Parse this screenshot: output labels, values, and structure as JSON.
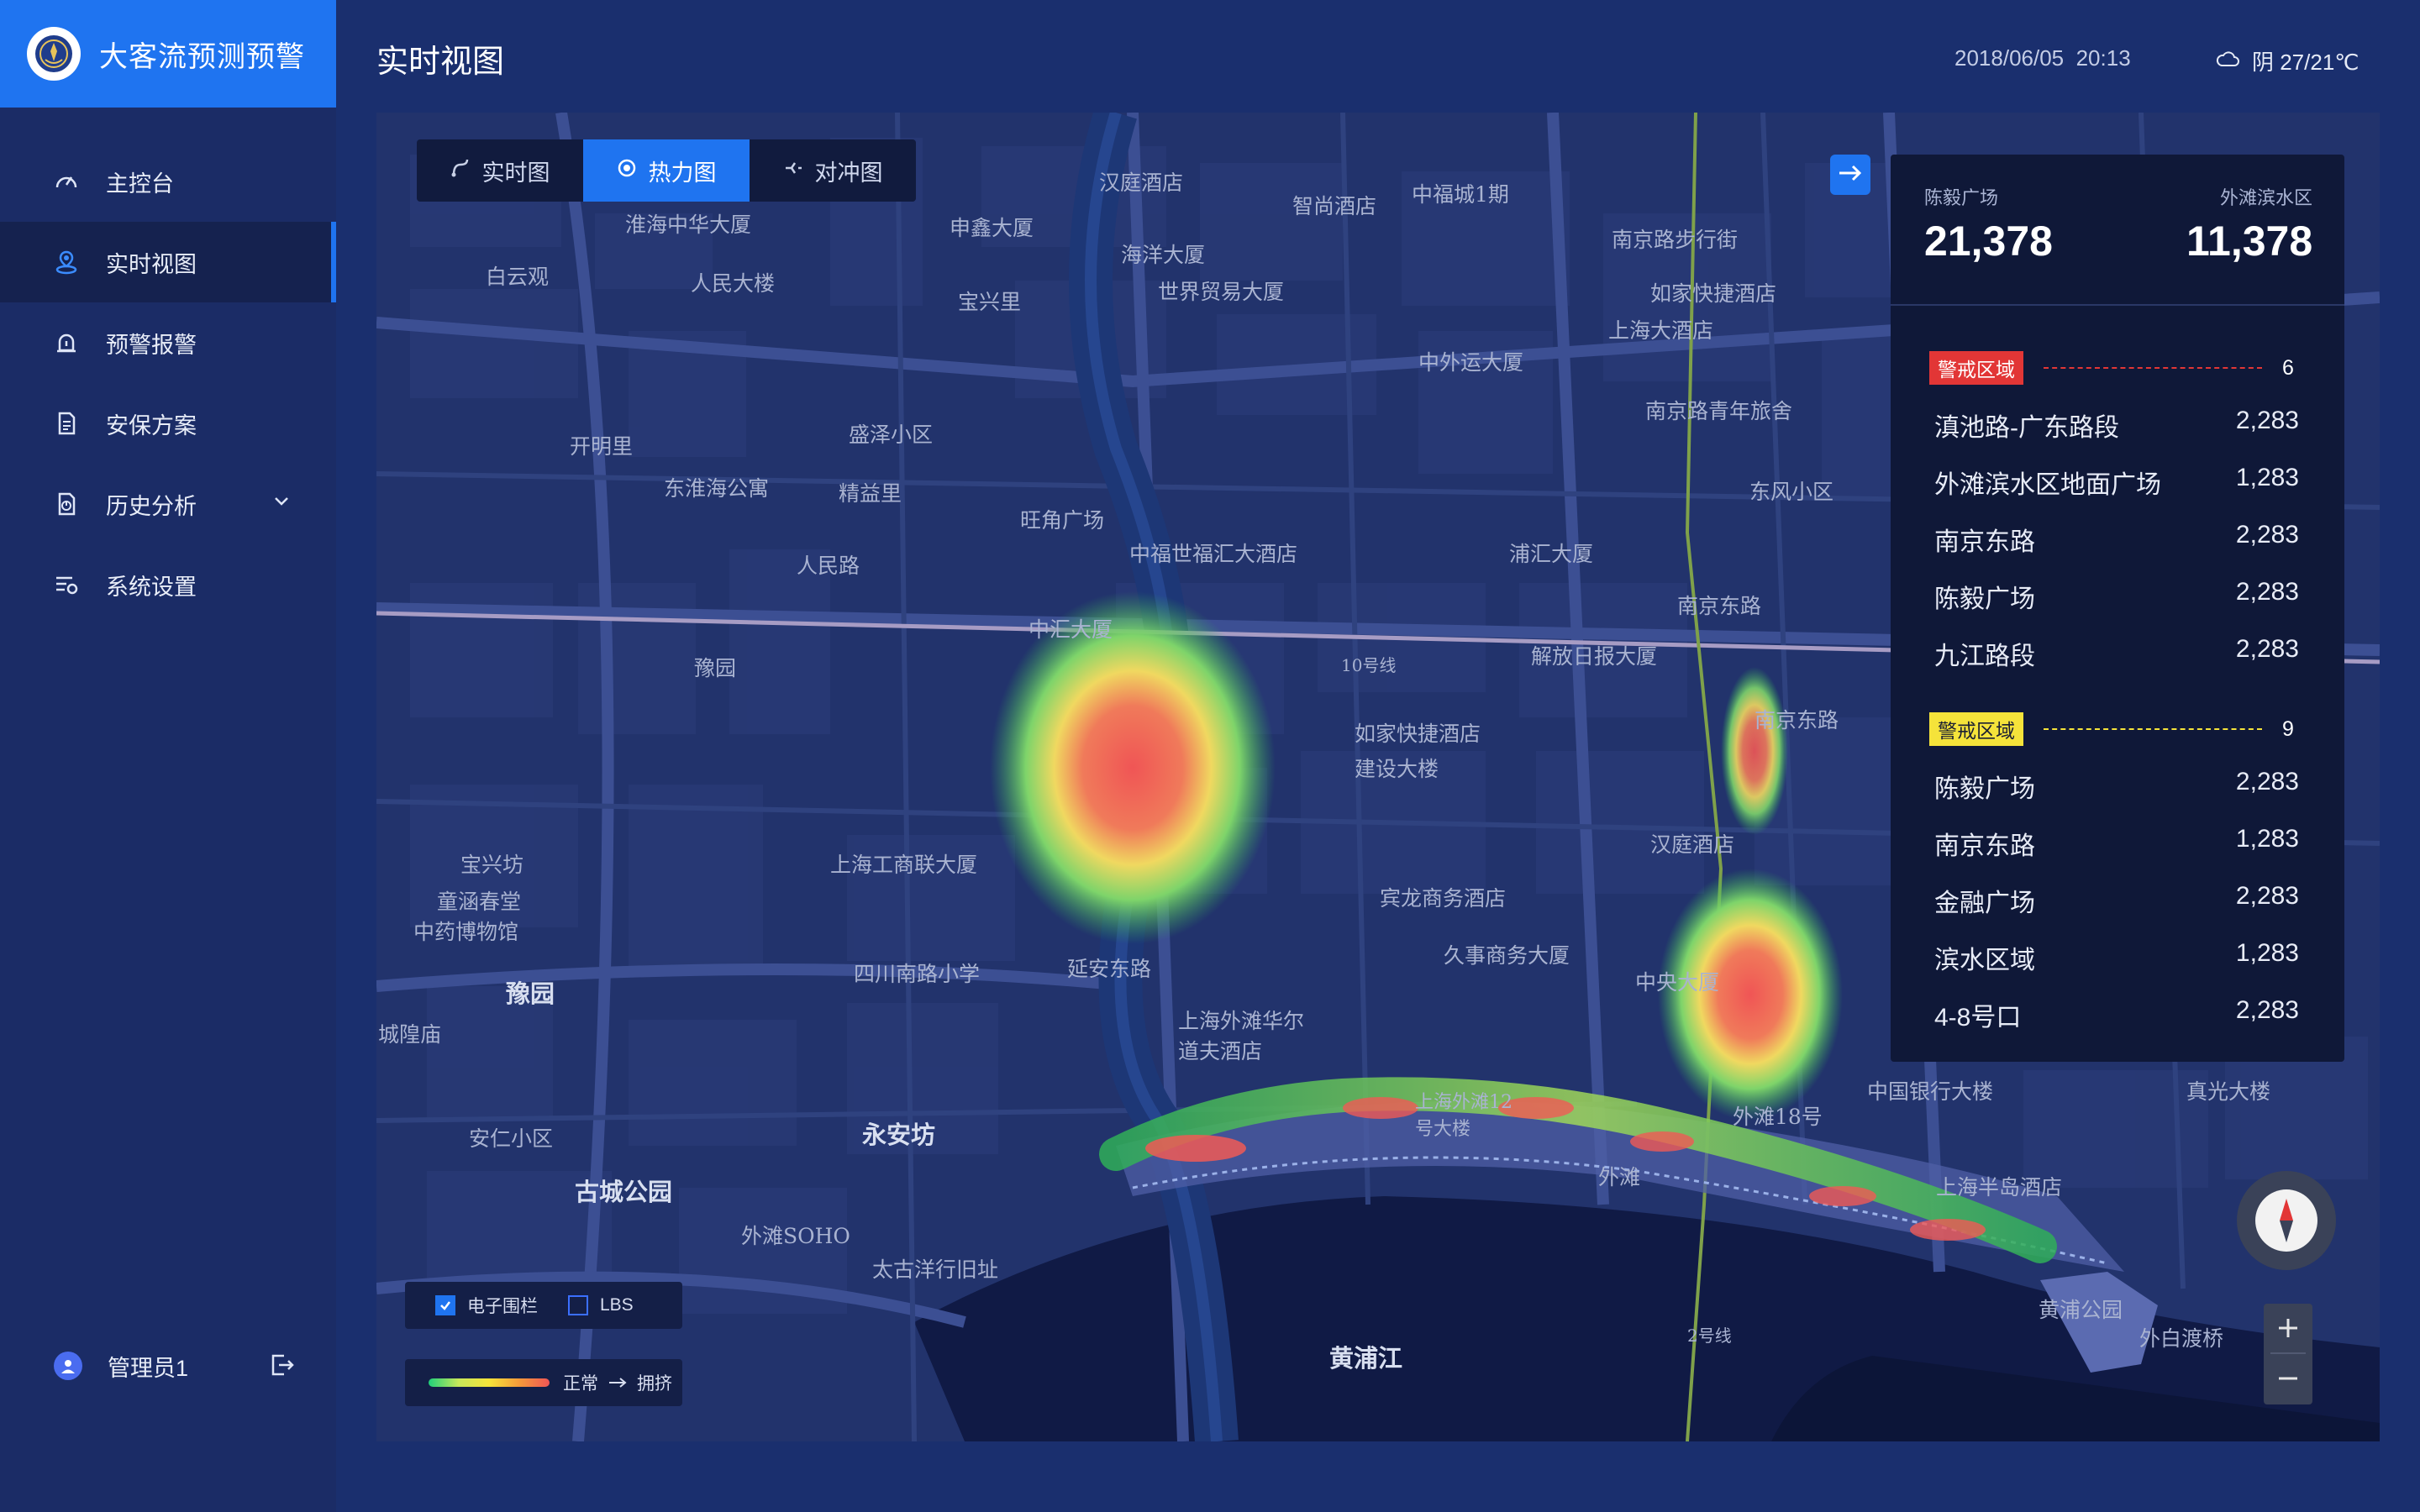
{
  "app": {
    "title": "大客流预测预警"
  },
  "sidebar": {
    "items": [
      {
        "label": "主控台",
        "icon": "gauge-icon"
      },
      {
        "label": "实时视图",
        "icon": "location-icon",
        "active": true
      },
      {
        "label": "预警报警",
        "icon": "alarm-icon"
      },
      {
        "label": "安保方案",
        "icon": "document-icon"
      },
      {
        "label": "历史分析",
        "icon": "report-icon",
        "has_submenu": true
      },
      {
        "label": "系统设置",
        "icon": "settings-icon"
      }
    ],
    "user": {
      "name": "管理员1"
    }
  },
  "header": {
    "title": "实时视图",
    "date": "2018/06/05",
    "time": "20:13",
    "weather": "阴 27/21℃"
  },
  "map": {
    "tabs": [
      {
        "label": "实时图"
      },
      {
        "label": "热力图",
        "active": true
      },
      {
        "label": "对冲图"
      }
    ],
    "labels": [
      "淮海中华大厦",
      "申鑫大厦",
      "汉庭酒店",
      "智尚酒店",
      "中福城1期",
      "南京路步行街",
      "白云观",
      "人民大楼",
      "海洋大厦",
      "世界贸易大厦",
      "宝兴里",
      "如家快捷酒店",
      "上海大酒店",
      "中外运大厦",
      "南京路青年旅舍",
      "开明里",
      "盛泽小区",
      "东淮海公寓",
      "精益里",
      "东风小区",
      "旺角广场",
      "中福世福汇大酒店",
      "浦汇大厦",
      "南京东路",
      "中汇大厦",
      "解放日报大厦",
      "豫园",
      "南京东路",
      "如家快捷酒店",
      "建设大楼",
      "宝兴坊",
      "童涵春堂",
      "中药博物馆",
      "上海工商联大厦",
      "汉庭酒店",
      "宾龙商务酒店",
      "四川南路小学",
      "久事商务大厦",
      "中央大厦",
      "豫园",
      "城隍庙",
      "上海外滩华尔道夫酒店",
      "上海外滩12号大楼",
      "外滩18号",
      "中国银行大楼",
      "真光大楼",
      "安仁小区",
      "永安坊",
      "外滩",
      "上海半岛酒店",
      "古城公园",
      "外滩SOHO",
      "太古洋行旧址",
      "黄浦公园",
      "外白渡桥",
      "黄浦江",
      "延安东路",
      "人民路",
      "2号线",
      "10号线"
    ],
    "layers": [
      {
        "label": "电子围栏",
        "checked": true
      },
      {
        "label": "LBS",
        "checked": false
      }
    ],
    "legend": {
      "from": "正常",
      "to": "拥挤"
    }
  },
  "stats": {
    "kpis": [
      {
        "label": "陈毅广场",
        "value": "21,378"
      },
      {
        "label": "外滩滨水区",
        "value": "11,378"
      }
    ],
    "zones": [
      {
        "badge": "警戒区域",
        "level": "red",
        "count": "6",
        "rows": [
          {
            "name": "滇池路-广东路段",
            "value": "2,283"
          },
          {
            "name": "外滩滨水区地面广场",
            "value": "1,283"
          },
          {
            "name": "南京东路",
            "value": "2,283"
          },
          {
            "name": "陈毅广场",
            "value": "2,283"
          },
          {
            "name": "九江路段",
            "value": "2,283"
          }
        ]
      },
      {
        "badge": "警戒区域",
        "level": "yellow",
        "count": "9",
        "rows": [
          {
            "name": "陈毅广场",
            "value": "2,283"
          },
          {
            "name": "南京东路",
            "value": "1,283"
          },
          {
            "name": "金融广场",
            "value": "2,283"
          },
          {
            "name": "滨水区域",
            "value": "1,283"
          },
          {
            "name": "4-8号口",
            "value": "2,283"
          }
        ]
      }
    ]
  },
  "colors": {
    "accent": "#1f74f0",
    "sidebar": "#1b2c66",
    "alert_red": "#e23636",
    "alert_yellow": "#f5e33a"
  }
}
